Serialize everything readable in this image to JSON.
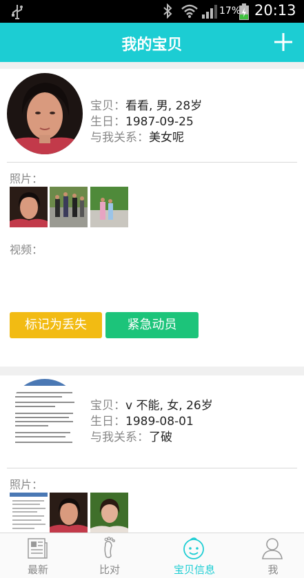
{
  "status_bar": {
    "battery_percent": "17%",
    "time": "20:13"
  },
  "header": {
    "title": "我的宝贝"
  },
  "labels": {
    "baobei": "宝贝：",
    "birthday": "生日：",
    "relation": "与我关系：",
    "photos": "照片：",
    "videos": "视频："
  },
  "babies": [
    {
      "summary": "看看, 男, 28岁",
      "birthday": "1987-09-25",
      "relation": "美女呢",
      "actions": {
        "mark_lost": "标记为丢失",
        "emergency": "紧急动员"
      }
    },
    {
      "summary": "v 不能, 女, 26岁",
      "birthday": "1989-08-01",
      "relation": "了破"
    }
  ],
  "tabbar": {
    "tabs": [
      {
        "label": "最新",
        "icon": "newspaper-icon"
      },
      {
        "label": "比对",
        "icon": "footprint-icon"
      },
      {
        "label": "宝贝信息",
        "icon": "baby-face-icon"
      },
      {
        "label": "我",
        "icon": "person-icon"
      }
    ],
    "active_index": 2
  },
  "colors": {
    "accent": "#1ccdd3",
    "lost_button": "#f2bb13",
    "emergency_button": "#1cc47a"
  }
}
